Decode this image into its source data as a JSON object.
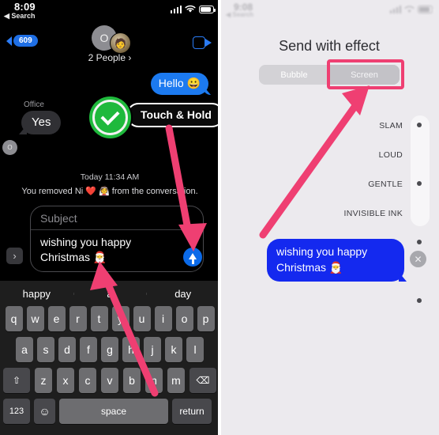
{
  "left_phone": {
    "status_bar": {
      "time": "8:09",
      "back_app": "◀ Search",
      "signal_icon": "cellular-bars-icon",
      "wifi_icon": "wifi-icon",
      "battery_icon": "battery-icon"
    },
    "header": {
      "back_badge": "609",
      "back_icon": "chevron-left-icon",
      "avatar_initial": "O",
      "avatar_second": "🧑",
      "participants": "2 People ›",
      "facetime_icon": "video-camera-icon"
    },
    "messages": [
      {
        "type": "outgoing",
        "text": "Hello 😀"
      },
      {
        "type": "sender_name",
        "text": "Office"
      },
      {
        "type": "incoming",
        "text": "Yes",
        "avatar": "O"
      },
      {
        "type": "timestamp",
        "text": "Today 11:34 AM"
      },
      {
        "type": "system",
        "text": "You removed Ni ❤️ 👰 from the conversation."
      }
    ],
    "compose": {
      "subject_placeholder": "Subject",
      "body_text": "wishing you happy Christmas 🎅",
      "expand_icon": "chevron-right-icon",
      "send_icon": "arrow-up-icon"
    },
    "keyboard": {
      "predictions": [
        "happy",
        "a",
        "day"
      ],
      "row1": [
        "q",
        "w",
        "e",
        "r",
        "t",
        "y",
        "u",
        "i",
        "o",
        "p"
      ],
      "row2": [
        "a",
        "s",
        "d",
        "f",
        "g",
        "h",
        "j",
        "k",
        "l"
      ],
      "row3": [
        "z",
        "x",
        "c",
        "v",
        "b",
        "n",
        "m"
      ],
      "shift_icon": "shift-up-icon",
      "backspace_icon": "backspace-icon",
      "numbers_key": "123",
      "emoji_icon": "smiley-icon",
      "space_key": "space",
      "return_key": "return"
    },
    "callout": {
      "label": "Touch & Hold",
      "check_icon": "green-check-circle-icon"
    }
  },
  "right_phone": {
    "status_bar": {
      "time": "9:08",
      "back_app": "◀ Search",
      "signal_icon": "cellular-bars-icon",
      "wifi_icon": "wifi-icon",
      "battery_icon": "battery-icon"
    },
    "title": "Send with effect",
    "segmented": {
      "bubble_label": "Bubble",
      "screen_label": "Screen",
      "selected": "Screen"
    },
    "effects": [
      {
        "label": "SLAM",
        "selected": false
      },
      {
        "label": "LOUD",
        "selected": false
      },
      {
        "label": "GENTLE",
        "selected": false
      },
      {
        "label": "INVISIBLE INK",
        "selected": false
      }
    ],
    "preview_bubble": "wishing you happy Christmas 🎅",
    "close_icon": "close-x-icon"
  },
  "annotations": {
    "highlight_color": "#ef3f72",
    "arrow_color": "#ef3f72",
    "arrow_count": 3
  }
}
